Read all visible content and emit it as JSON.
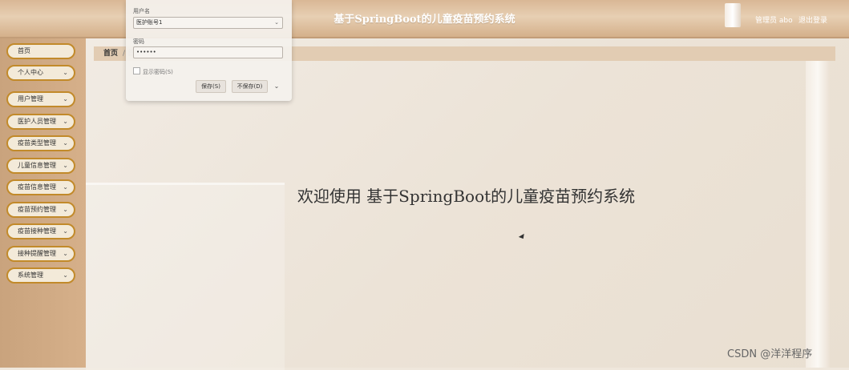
{
  "header": {
    "title": "基于SpringBoot的儿童疫苗预约系统",
    "user": "管理员 abo",
    "logout": "退出登录"
  },
  "sidebar": {
    "items": [
      {
        "label": "首页",
        "has_chevron": false
      },
      {
        "label": "个人中心",
        "has_chevron": true
      },
      {
        "label": "用户管理",
        "has_chevron": true
      },
      {
        "label": "医护人员管理",
        "has_chevron": true
      },
      {
        "label": "疫苗类型管理",
        "has_chevron": true
      },
      {
        "label": "儿童信息管理",
        "has_chevron": true
      },
      {
        "label": "疫苗信息管理",
        "has_chevron": true
      },
      {
        "label": "疫苗预约管理",
        "has_chevron": true
      },
      {
        "label": "疫苗接种管理",
        "has_chevron": true
      },
      {
        "label": "接种提醒管理",
        "has_chevron": true
      },
      {
        "label": "系统管理",
        "has_chevron": true
      }
    ],
    "chevron_glyph": "⌄"
  },
  "breadcrumb": {
    "home": "首页",
    "sep": "/",
    "current": "首页"
  },
  "main": {
    "welcome": "欢迎使用 基于SpringBoot的儿童疫苗预约系统"
  },
  "password_popup": {
    "username_label": "用户名",
    "username_value": "医护账号1",
    "password_label": "密码",
    "password_value": "••••••",
    "show_password_label": "显示密码(S)",
    "save_label": "保存(S)",
    "nosave_label": "不保存(D)",
    "dropdown_glyph": "⌄"
  },
  "watermark": "CSDN @洋洋程序",
  "colors": {
    "header": "#d9b795",
    "sidebar": "#c9a37d",
    "menu_border": "#c28a2a",
    "menu_bg": "#f3ead9",
    "breadcrumb_bg": "#e2ccb3"
  }
}
